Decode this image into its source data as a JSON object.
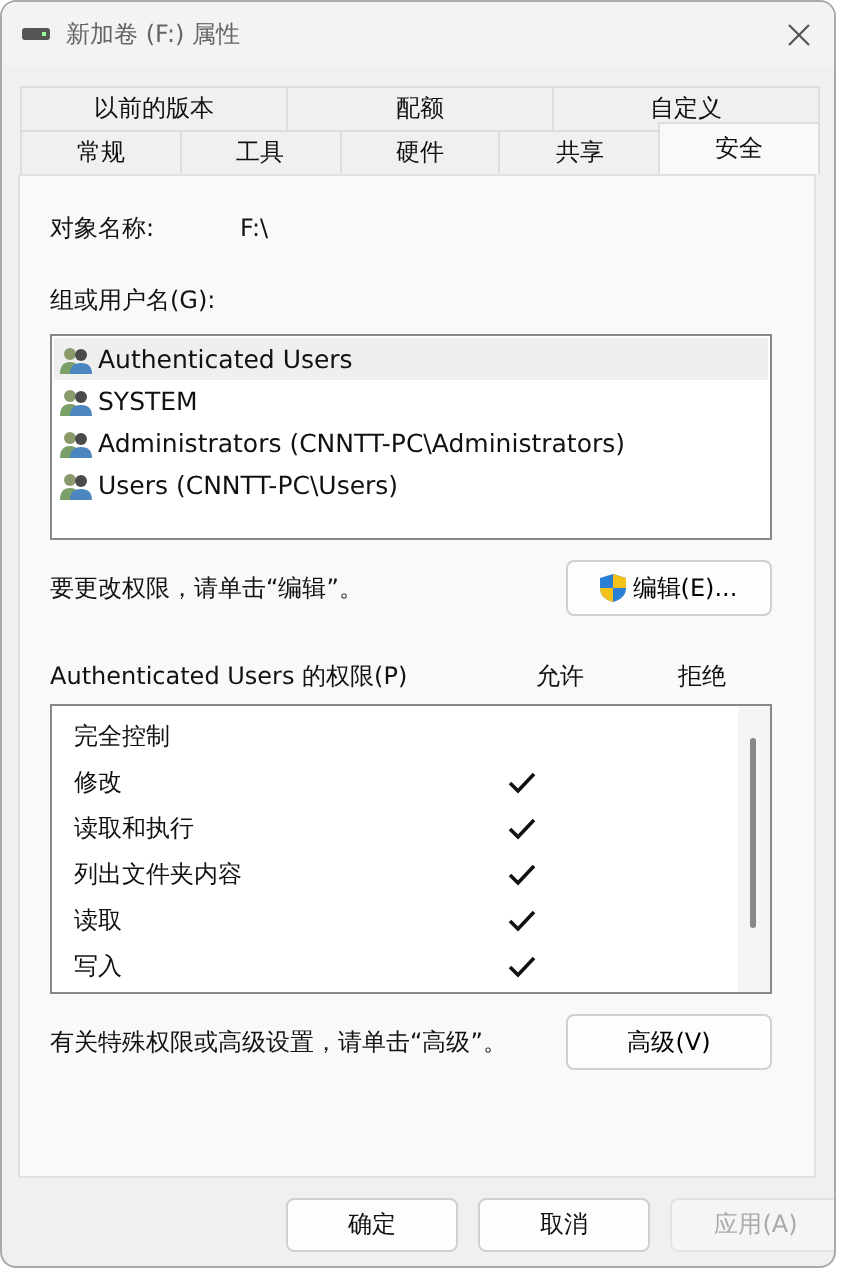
{
  "window": {
    "title": "新加卷 (F:) 属性"
  },
  "tab_rows": [
    [
      {
        "label": "以前的版本",
        "selected": false
      },
      {
        "label": "配额",
        "selected": false
      },
      {
        "label": "自定义",
        "selected": false
      }
    ],
    [
      {
        "label": "常规",
        "selected": false
      },
      {
        "label": "工具",
        "selected": false
      },
      {
        "label": "硬件",
        "selected": false
      },
      {
        "label": "共享",
        "selected": false
      },
      {
        "label": "安全",
        "selected": true
      }
    ]
  ],
  "object_name": {
    "label": "对象名称:",
    "value": "F:\\"
  },
  "groups": {
    "label": "组或用户名(G):",
    "items": [
      {
        "name": "Authenticated Users",
        "selected": true
      },
      {
        "name": "SYSTEM",
        "selected": false
      },
      {
        "name": "Administrators (CNNTT-PC\\Administrators)",
        "selected": false
      },
      {
        "name": "Users (CNNTT-PC\\Users)",
        "selected": false
      }
    ]
  },
  "edit_hint": "要更改权限，请单击“编辑”。",
  "edit_button": "编辑(E)...",
  "permissions": {
    "label": "Authenticated Users 的权限(P)",
    "allow_header": "允许",
    "deny_header": "拒绝",
    "rows": [
      {
        "name": "完全控制",
        "allow": false,
        "deny": false
      },
      {
        "name": "修改",
        "allow": true,
        "deny": false
      },
      {
        "name": "读取和执行",
        "allow": true,
        "deny": false
      },
      {
        "name": "列出文件夹内容",
        "allow": true,
        "deny": false
      },
      {
        "name": "读取",
        "allow": true,
        "deny": false
      },
      {
        "name": "写入",
        "allow": true,
        "deny": false
      }
    ]
  },
  "advanced_hint": "有关特殊权限或高级设置，请单击“高级”。",
  "advanced_button": "高级(V)",
  "buttons": [
    {
      "label": "确定",
      "disabled": false
    },
    {
      "label": "取消",
      "disabled": false
    },
    {
      "label": "应用(A)",
      "disabled": true
    }
  ]
}
